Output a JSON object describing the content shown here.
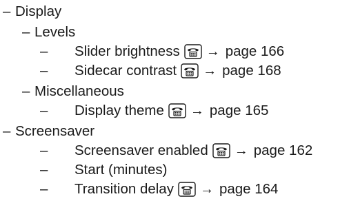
{
  "outline": {
    "dash": "–",
    "display": {
      "label": "Display"
    },
    "levels": {
      "label": "Levels"
    },
    "slider_brightness": {
      "label": "Slider brightness",
      "page": "page 166"
    },
    "sidecar_contrast": {
      "label": "Sidecar contrast",
      "page": "page 168"
    },
    "miscellaneous": {
      "label": "Miscellaneous"
    },
    "display_theme": {
      "label": "Display theme",
      "page": "page 165"
    },
    "screensaver": {
      "label": "Screensaver"
    },
    "screensaver_enabled": {
      "label": "Screensaver enabled",
      "page": "page 162"
    },
    "start_minutes": {
      "label": "Start (minutes)"
    },
    "transition_delay": {
      "label": "Transition delay",
      "page": "page 164"
    },
    "arrow": "→"
  },
  "icons": {
    "phone": "phone-icon"
  }
}
